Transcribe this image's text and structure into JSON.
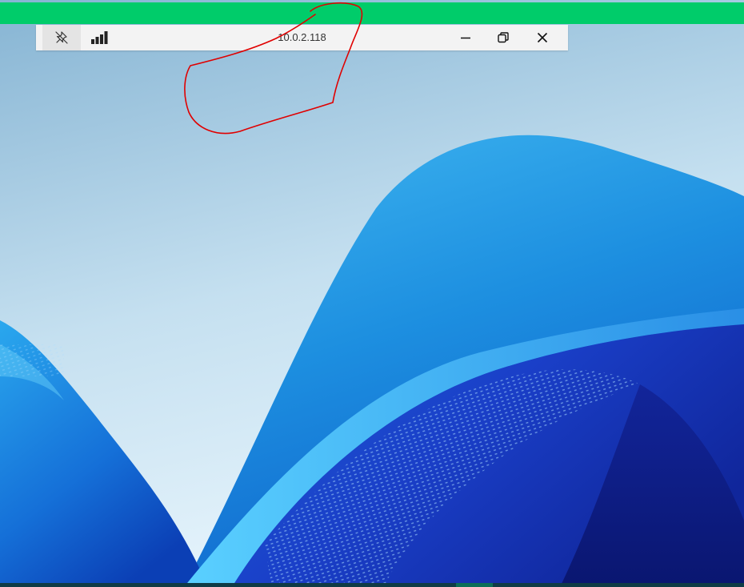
{
  "window": {
    "host": "10.0.2.118"
  },
  "connection_bar": {
    "pin_icon": "pin-off-icon",
    "signal_icon": "signal-strength-icon",
    "minimize_icon": "minimize-icon",
    "restore_icon": "restore-icon",
    "close_icon": "close-icon"
  },
  "colors": {
    "top_bar": "#00cc6a",
    "connection_bar_bg": "#f3f3f3",
    "annotation_stroke": "#e00000",
    "wallpaper_sky_top": "#8fb9d6",
    "wallpaper_sky_bottom": "#dceefa",
    "wallpaper_wave_light": "#2aa6ea",
    "wallpaper_wave_dark": "#1a3fd0",
    "taskbar": "#0f3b46",
    "taskbar_active": "#0b6e58"
  }
}
